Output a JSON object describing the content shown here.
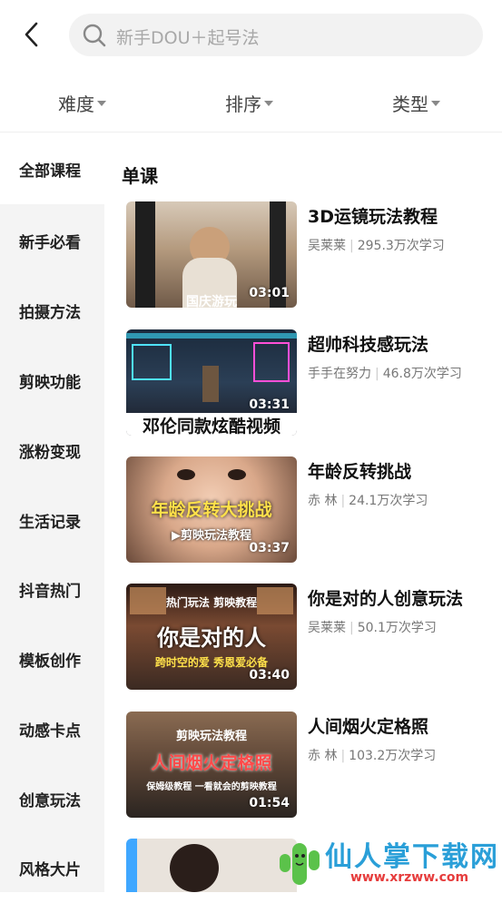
{
  "search": {
    "placeholder": "新手DOU＋起号法"
  },
  "filters": [
    {
      "label": "难度"
    },
    {
      "label": "排序"
    },
    {
      "label": "类型"
    }
  ],
  "sidebar": {
    "items": [
      {
        "label": "全部课程"
      },
      {
        "label": "新手必看"
      },
      {
        "label": "拍摄方法"
      },
      {
        "label": "剪映功能"
      },
      {
        "label": "涨粉变现"
      },
      {
        "label": "生活记录"
      },
      {
        "label": "抖音热门"
      },
      {
        "label": "模板创作"
      },
      {
        "label": "动感卡点"
      },
      {
        "label": "创意玩法"
      },
      {
        "label": "风格大片"
      }
    ],
    "active_index": 0
  },
  "section": {
    "title": "单课"
  },
  "courses": [
    {
      "title": "3D运镜玩法教程",
      "author": "吴莱莱",
      "views": "295.3万次学习",
      "duration": "03:01",
      "caption": "国庆游玩"
    },
    {
      "title": "超帅科技感玩法",
      "author": "手手在努力",
      "views": "46.8万次学习",
      "duration": "03:31",
      "caption": "邓伦同款炫酷视频"
    },
    {
      "title": "年龄反转挑战",
      "author": "赤 林",
      "views": "24.1万次学习",
      "duration": "03:37",
      "caption": "年龄反转大挑战",
      "subcaption": "▶剪映玩法教程"
    },
    {
      "title": "你是对的人创意玩法",
      "author": "吴莱莱",
      "views": "50.1万次学习",
      "duration": "03:40",
      "caption": "你是对的人",
      "subcaption": "热门玩法 剪映教程",
      "subcaption2": "跨时空的爱 秀恩爱必备"
    },
    {
      "title": "人间烟火定格照",
      "author": "赤 林",
      "views": "103.2万次学习",
      "duration": "01:54",
      "caption": "人间烟火定格照",
      "subcaption": "剪映玩法教程",
      "subcaption2": "保姆级教程 一看就会的剪映教程"
    }
  ],
  "watermark": {
    "text": "仙人掌下载网",
    "url": "www.xrzww.com"
  }
}
